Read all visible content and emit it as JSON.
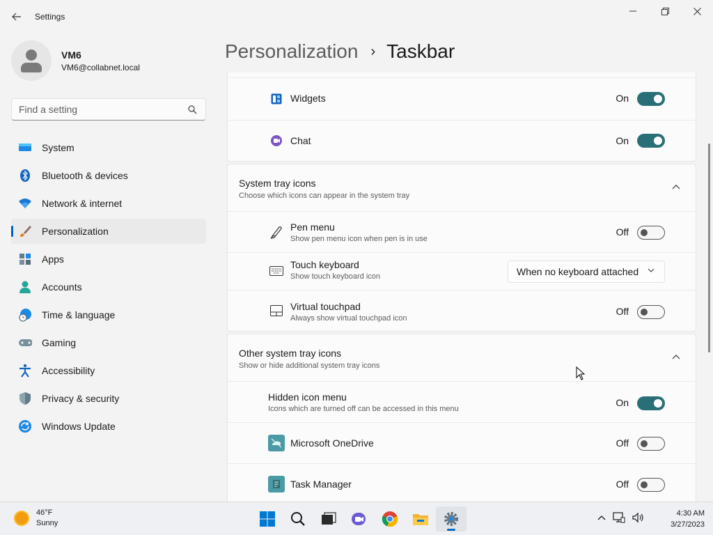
{
  "window": {
    "title": "Settings",
    "back_label": "←"
  },
  "profile": {
    "name": "VM6",
    "email": "VM6@collabnet.local"
  },
  "search": {
    "placeholder": "Find a setting",
    "value": ""
  },
  "sidebar": {
    "items": [
      {
        "label": "System",
        "icon": "monitor-icon"
      },
      {
        "label": "Bluetooth & devices",
        "icon": "bluetooth-icon"
      },
      {
        "label": "Network & internet",
        "icon": "wifi-icon"
      },
      {
        "label": "Personalization",
        "icon": "brush-icon",
        "active": true
      },
      {
        "label": "Apps",
        "icon": "apps-icon"
      },
      {
        "label": "Accounts",
        "icon": "person-icon"
      },
      {
        "label": "Time & language",
        "icon": "globe-clock-icon"
      },
      {
        "label": "Gaming",
        "icon": "gamepad-icon"
      },
      {
        "label": "Accessibility",
        "icon": "accessibility-icon"
      },
      {
        "label": "Privacy & security",
        "icon": "shield-icon"
      },
      {
        "label": "Windows Update",
        "icon": "update-icon"
      }
    ]
  },
  "header": {
    "parent": "Personalization",
    "separator": "›",
    "current": "Taskbar"
  },
  "taskbar_items": {
    "widgets": {
      "label": "Widgets",
      "state": "On",
      "on": true
    },
    "chat": {
      "label": "Chat",
      "state": "On",
      "on": true
    }
  },
  "system_tray": {
    "title": "System tray icons",
    "subtitle": "Choose which icons can appear in the system tray",
    "pen_menu": {
      "title": "Pen menu",
      "subtitle": "Show pen menu icon when pen is in use",
      "state": "Off",
      "on": false
    },
    "touch_keyboard": {
      "title": "Touch keyboard",
      "subtitle": "Show touch keyboard icon",
      "selected": "When no keyboard attached"
    },
    "virtual_touchpad": {
      "title": "Virtual touchpad",
      "subtitle": "Always show virtual touchpad icon",
      "state": "Off",
      "on": false
    }
  },
  "other_tray": {
    "title": "Other system tray icons",
    "subtitle": "Show or hide additional system tray icons",
    "hidden_menu": {
      "title": "Hidden icon menu",
      "subtitle": "Icons which are turned off can be accessed in this menu",
      "state": "On",
      "on": true
    },
    "onedrive": {
      "title": "Microsoft OneDrive",
      "state": "Off",
      "on": false
    },
    "task_manager": {
      "title": "Task Manager",
      "state": "Off",
      "on": false
    }
  },
  "weather": {
    "temp": "46°F",
    "condition": "Sunny"
  },
  "taskbar_apps": [
    "start-icon",
    "search-icon",
    "task-view-icon",
    "chat-icon",
    "chrome-icon",
    "file-explorer-icon",
    "settings-icon"
  ],
  "clock": {
    "time": "4:30 AM",
    "date": "3/27/2023"
  },
  "colors": {
    "accent": "#005fb8",
    "toggle_on": "#2a6f78"
  }
}
